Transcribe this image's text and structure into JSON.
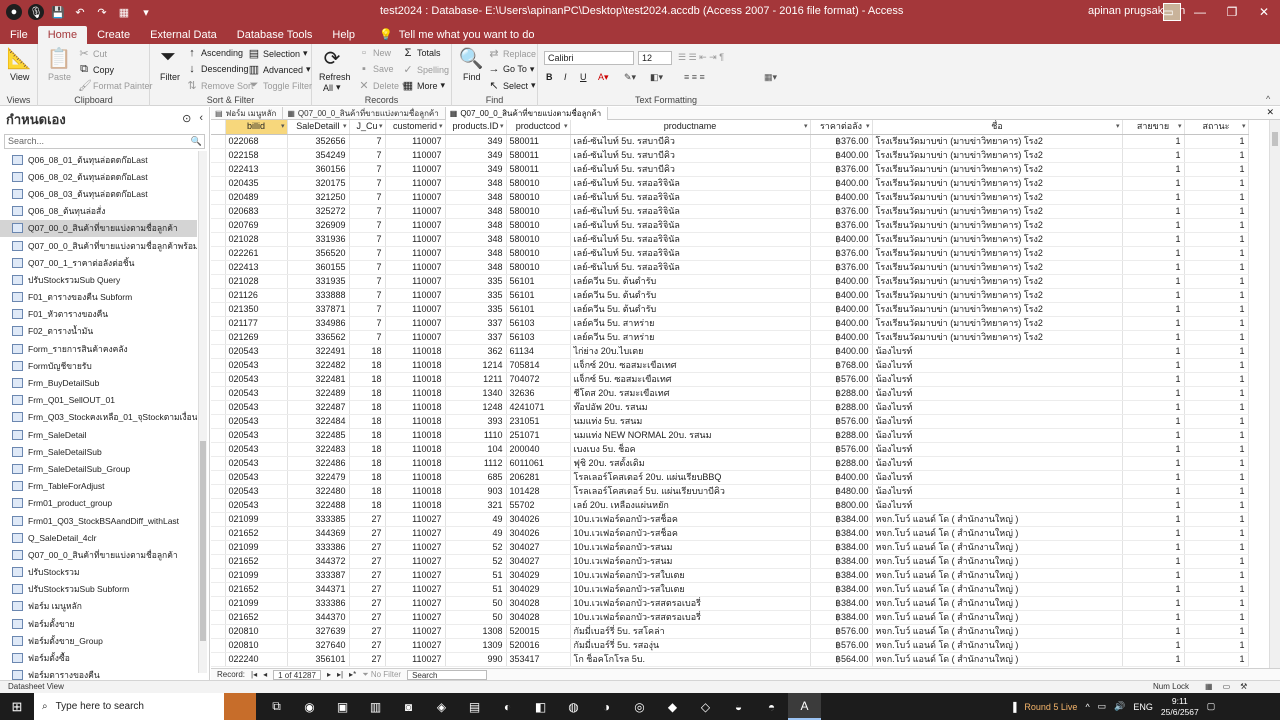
{
  "window": {
    "title": "test2024 : Database- E:\\Users\\apinanPC\\Desktop\\test2024.accdb (Access 2007 - 2016 file format) - Access",
    "user": "apinan prugsakarun"
  },
  "ribbon_tabs": [
    "File",
    "Home",
    "Create",
    "External Data",
    "Database Tools",
    "Help"
  ],
  "active_tab": "Home",
  "tell_me": "Tell me what you want to do",
  "ribbon": {
    "views": {
      "view": "View",
      "label": "Views"
    },
    "clipboard": {
      "paste": "Paste",
      "cut": "Cut",
      "copy": "Copy",
      "format_painter": "Format Painter",
      "label": "Clipboard"
    },
    "sort_filter": {
      "filter": "Filter",
      "ascending": "Ascending",
      "descending": "Descending",
      "remove_sort": "Remove Sort",
      "selection": "Selection",
      "advanced": "Advanced",
      "toggle_filter": "Toggle Filter",
      "label": "Sort & Filter"
    },
    "records": {
      "refresh": "Refresh",
      "refresh_all": "All",
      "new": "New",
      "save": "Save",
      "delete": "Delete",
      "totals": "Totals",
      "spelling": "Spelling",
      "more": "More",
      "label": "Records"
    },
    "find": {
      "find": "Find",
      "replace": "Replace",
      "goto": "Go To",
      "select": "Select",
      "label": "Find"
    },
    "text_formatting": {
      "font": "Calibri",
      "size": "12",
      "bold": "B",
      "italic": "I",
      "underline": "U",
      "label": "Text Formatting"
    }
  },
  "nav": {
    "title": "กำหนดเอง",
    "search_placeholder": "Search...",
    "items": [
      "Q06_08_01_ต้นทุนล่อตดก๊อLast",
      "Q06_08_02_ต้นทุนล่อตดก๊อLast",
      "Q06_08_03_ต้นทุนล่อตดก๊อLast",
      "Q06_08_ต้นทุนล่อสั่ง",
      "Q07_00_0_สินค้าที่ขายแบ่งตามชื่อลูกค้า",
      "Q07_00_0_สินค้าที่ขายแบ่งตามชื่อลูกค้าพร้อมรหัสลูกค้า",
      "Q07_00_1_ราคาต่อลังต่อชิ้น",
      "ปรับStockรวมSub Query",
      "F01_ตารางของคืน Subform",
      "F01_หัวตารางของคืน",
      "F02_ตารางน้ำมัน",
      "Form_รายการสินค้าคงคลัง",
      "Formบัญชีขายรับ",
      "Frm_BuyDetailSub",
      "Frm_Q01_SellOUT_01",
      "Frm_Q03_Stockคงเหลือ_01_จุStockตามเงื่อนไข",
      "Frm_SaleDetail",
      "Frm_SaleDetailSub",
      "Frm_SaleDetailSub_Group",
      "Frm_TableForAdjust",
      "Frm01_product_group",
      "Frm01_Q03_StockBSAandDiff_withLast",
      "Q_SaleDetail_4clr",
      "Q07_00_0_สินค้าที่ขายแบ่งตามชื่อลูกค้า",
      "ปรับStockรวม",
      "ปรับStockรวมSub Subform",
      "ฟอร์ม เมนูหลัก",
      "ฟอร์มตั้งขาย",
      "ฟอร์มตั้งขาย_Group",
      "ฟอร์มตั้งซื้อ",
      "ฟอร์มตารางของคืน"
    ],
    "selected_index": 4
  },
  "doc_tabs": [
    "ฟอร์ม เมนูหลัก",
    "Q07_00_0_สินค้าที่ขายแบ่งตามชื่อลูกค้า",
    "Q07_00_0_สินค้าที่ขายแบ่งตามชื่อลูกค้า"
  ],
  "active_doc_tab": 2,
  "grid": {
    "columns": [
      "billid",
      "SaleDetailI",
      "J_Cu",
      "customerid",
      "products.ID",
      "productcod",
      "productname",
      "ราคาต่อลัง",
      "ชื่อ",
      "สายขาย",
      "สถานะ"
    ],
    "rows": [
      [
        "022068",
        "352656",
        "7",
        "110007",
        "349",
        "580011",
        "เลย์-ซันไบท์ 5บ. รสบาบีคิว",
        "฿376.00",
        "โรงเรียนวัดมาบข่า (มาบข่าวิทยาคาร) โรง2",
        "1",
        "1"
      ],
      [
        "022158",
        "354249",
        "7",
        "110007",
        "349",
        "580011",
        "เลย์-ซันไบท์ 5บ. รสบาบีคิว",
        "฿400.00",
        "โรงเรียนวัดมาบข่า (มาบข่าวิทยาคาร) โรง2",
        "1",
        "1"
      ],
      [
        "022413",
        "360156",
        "7",
        "110007",
        "349",
        "580011",
        "เลย์-ซันไบท์ 5บ. รสบาบีคิว",
        "฿376.00",
        "โรงเรียนวัดมาบข่า (มาบข่าวิทยาคาร) โรง2",
        "1",
        "1"
      ],
      [
        "020435",
        "320175",
        "7",
        "110007",
        "348",
        "580010",
        "เลย์-ซันไบท์ 5บ. รสออริจินัล",
        "฿400.00",
        "โรงเรียนวัดมาบข่า (มาบข่าวิทยาคาร) โรง2",
        "1",
        "1"
      ],
      [
        "020489",
        "321250",
        "7",
        "110007",
        "348",
        "580010",
        "เลย์-ซันไบท์ 5บ. รสออริจินัล",
        "฿400.00",
        "โรงเรียนวัดมาบข่า (มาบข่าวิทยาคาร) โรง2",
        "1",
        "1"
      ],
      [
        "020683",
        "325272",
        "7",
        "110007",
        "348",
        "580010",
        "เลย์-ซันไบท์ 5บ. รสออริจินัล",
        "฿376.00",
        "โรงเรียนวัดมาบข่า (มาบข่าวิทยาคาร) โรง2",
        "1",
        "1"
      ],
      [
        "020769",
        "326909",
        "7",
        "110007",
        "348",
        "580010",
        "เลย์-ซันไบท์ 5บ. รสออริจินัล",
        "฿376.00",
        "โรงเรียนวัดมาบข่า (มาบข่าวิทยาคาร) โรง2",
        "1",
        "1"
      ],
      [
        "021028",
        "331936",
        "7",
        "110007",
        "348",
        "580010",
        "เลย์-ซันไบท์ 5บ. รสออริจินัล",
        "฿400.00",
        "โรงเรียนวัดมาบข่า (มาบข่าวิทยาคาร) โรง2",
        "1",
        "1"
      ],
      [
        "022261",
        "356520",
        "7",
        "110007",
        "348",
        "580010",
        "เลย์-ซันไบท์ 5บ. รสออริจินัล",
        "฿376.00",
        "โรงเรียนวัดมาบข่า (มาบข่าวิทยาคาร) โรง2",
        "1",
        "1"
      ],
      [
        "022413",
        "360155",
        "7",
        "110007",
        "348",
        "580010",
        "เลย์-ซันไบท์ 5บ. รสออริจินัล",
        "฿376.00",
        "โรงเรียนวัดมาบข่า (มาบข่าวิทยาคาร) โรง2",
        "1",
        "1"
      ],
      [
        "021028",
        "331935",
        "7",
        "110007",
        "335",
        "56101",
        "เลย์ควีน 5บ. ต้นตำรับ",
        "฿400.00",
        "โรงเรียนวัดมาบข่า (มาบข่าวิทยาคาร) โรง2",
        "1",
        "1"
      ],
      [
        "021126",
        "333888",
        "7",
        "110007",
        "335",
        "56101",
        "เลย์ควีน 5บ. ต้นตำรับ",
        "฿400.00",
        "โรงเรียนวัดมาบข่า (มาบข่าวิทยาคาร) โรง2",
        "1",
        "1"
      ],
      [
        "021350",
        "337871",
        "7",
        "110007",
        "335",
        "56101",
        "เลย์ควีน 5บ. ต้นตำรับ",
        "฿400.00",
        "โรงเรียนวัดมาบข่า (มาบข่าวิทยาคาร) โรง2",
        "1",
        "1"
      ],
      [
        "021177",
        "334986",
        "7",
        "110007",
        "337",
        "56103",
        "เลย์ควีน 5บ. สาหร่าย",
        "฿400.00",
        "โรงเรียนวัดมาบข่า (มาบข่าวิทยาคาร) โรง2",
        "1",
        "1"
      ],
      [
        "021269",
        "336562",
        "7",
        "110007",
        "337",
        "56103",
        "เลย์ควีน 5บ. สาหร่าย",
        "฿400.00",
        "โรงเรียนวัดมาบข่า (มาบข่าวิทยาคาร) โรง2",
        "1",
        "1"
      ],
      [
        "020543",
        "322491",
        "18",
        "110018",
        "362",
        "61134",
        "ไก่ย่าง 20บ.ไบเตย",
        "฿400.00",
        "น้องไบรท์",
        "1",
        "1"
      ],
      [
        "020543",
        "322482",
        "18",
        "110018",
        "1214",
        "705814",
        "แจ็กซ์ 20บ. ซอสมะเขือเทศ",
        "฿768.00",
        "น้องไบรท์",
        "1",
        "1"
      ],
      [
        "020543",
        "322481",
        "18",
        "110018",
        "1211",
        "704072",
        "แจ็กซ์ 5บ. ซอสมะเขือเทศ",
        "฿576.00",
        "น้องไบรท์",
        "1",
        "1"
      ],
      [
        "020543",
        "322489",
        "18",
        "110018",
        "1340",
        "32636",
        "ชีโตส 20บ. รสมะเขือเทศ",
        "฿288.00",
        "น้องไบรท์",
        "1",
        "1"
      ],
      [
        "020543",
        "322487",
        "18",
        "110018",
        "1248",
        "4241071",
        "ท๊อปอัพ 20บ. รสนม",
        "฿288.00",
        "น้องไบรท์",
        "1",
        "1"
      ],
      [
        "020543",
        "322484",
        "18",
        "110018",
        "393",
        "231051",
        "นมแท่ง 5บ. รสนม",
        "฿576.00",
        "น้องไบรท์",
        "1",
        "1"
      ],
      [
        "020543",
        "322485",
        "18",
        "110018",
        "1110",
        "251071",
        "นมแท่ง NEW NORMAL 20บ. รสนม",
        "฿288.00",
        "น้องไบรท์",
        "1",
        "1"
      ],
      [
        "020543",
        "322483",
        "18",
        "110018",
        "104",
        "200040",
        "เบงเบง 5บ. ช็อค",
        "฿576.00",
        "น้องไบรท์",
        "1",
        "1"
      ],
      [
        "020543",
        "322486",
        "18",
        "110018",
        "1112",
        "6011061",
        "ฟุชิ 20บ. รสดั้งเดิม",
        "฿288.00",
        "น้องไบรท์",
        "1",
        "1"
      ],
      [
        "020543",
        "322479",
        "18",
        "110018",
        "685",
        "206281",
        "โรลเลอร์โคสเตอร์ 20บ. แผ่นเรียบBBQ",
        "฿400.00",
        "น้องไบรท์",
        "1",
        "1"
      ],
      [
        "020543",
        "322480",
        "18",
        "110018",
        "903",
        "101428",
        "โรลเลอร์โคสเตอร์ 5บ. แผ่นเรียบบาบีคิว",
        "฿480.00",
        "น้องไบรท์",
        "1",
        "1"
      ],
      [
        "020543",
        "322488",
        "18",
        "110018",
        "321",
        "55702",
        "เลย์ 20บ. เหลืองแผ่นหยัก",
        "฿800.00",
        "น้องไบรท์",
        "1",
        "1"
      ],
      [
        "021099",
        "333385",
        "27",
        "110027",
        "49",
        "304026",
        "10บ.เวเฟอร์ดอกบัว-รสช็อค",
        "฿384.00",
        "หจก.โบว์ แอนด์ โด ( สำนักงานใหญ่ )",
        "1",
        "1"
      ],
      [
        "021652",
        "344369",
        "27",
        "110027",
        "49",
        "304026",
        "10บ.เวเฟอร์ดอกบัว-รสช็อค",
        "฿384.00",
        "หจก.โบว์ แอนด์ โด ( สำนักงานใหญ่ )",
        "1",
        "1"
      ],
      [
        "021099",
        "333386",
        "27",
        "110027",
        "52",
        "304027",
        "10บ.เวเฟอร์ดอกบัว-รสนม",
        "฿384.00",
        "หจก.โบว์ แอนด์ โด ( สำนักงานใหญ่ )",
        "1",
        "1"
      ],
      [
        "021652",
        "344372",
        "27",
        "110027",
        "52",
        "304027",
        "10บ.เวเฟอร์ดอกบัว-รสนม",
        "฿384.00",
        "หจก.โบว์ แอนด์ โด ( สำนักงานใหญ่ )",
        "1",
        "1"
      ],
      [
        "021099",
        "333387",
        "27",
        "110027",
        "51",
        "304029",
        "10บ.เวเฟอร์ดอกบัว-รสใบเตย",
        "฿384.00",
        "หจก.โบว์ แอนด์ โด ( สำนักงานใหญ่ )",
        "1",
        "1"
      ],
      [
        "021652",
        "344371",
        "27",
        "110027",
        "51",
        "304029",
        "10บ.เวเฟอร์ดอกบัว-รสใบเตย",
        "฿384.00",
        "หจก.โบว์ แอนด์ โด ( สำนักงานใหญ่ )",
        "1",
        "1"
      ],
      [
        "021099",
        "333386",
        "27",
        "110027",
        "50",
        "304028",
        "10บ.เวเฟอร์ดอกบัว-รสสตรอเบอรี่",
        "฿384.00",
        "หจก.โบว์ แอนด์ โด ( สำนักงานใหญ่ )",
        "1",
        "1"
      ],
      [
        "021652",
        "344370",
        "27",
        "110027",
        "50",
        "304028",
        "10บ.เวเฟอร์ดอกบัว-รสสตรอเบอรี่",
        "฿384.00",
        "หจก.โบว์ แอนด์ โด ( สำนักงานใหญ่ )",
        "1",
        "1"
      ],
      [
        "020810",
        "327639",
        "27",
        "110027",
        "1308",
        "520015",
        "กัมมี่เบอร์รี่ 5บ. รสโคล่า",
        "฿576.00",
        "หจก.โบว์ แอนด์ โด ( สำนักงานใหญ่ )",
        "1",
        "1"
      ],
      [
        "020810",
        "327640",
        "27",
        "110027",
        "1309",
        "520016",
        "กัมมี่เบอร์รี่ 5บ. รสองุ่น",
        "฿576.00",
        "หจก.โบว์ แอนด์ โด ( สำนักงานใหญ่ )",
        "1",
        "1"
      ],
      [
        "022240",
        "356101",
        "27",
        "110027",
        "990",
        "353417",
        "โก ช็อคโกโรล 5บ.",
        "฿564.00",
        "หจก.โบว์ แอนด์ โด ( สำนักงานใหญ่ )",
        "1",
        "1"
      ]
    ]
  },
  "record_nav": {
    "label": "Record:",
    "position": "1 of 41287",
    "filter": "No Filter",
    "search": "Search"
  },
  "status": {
    "left": "Datasheet View",
    "numlock": "Num Lock"
  },
  "taskbar": {
    "search": "Type here to search",
    "tray_app": "Round 5 Live",
    "lang": "ENG",
    "time": "9:11",
    "date": "25/6/2567"
  }
}
